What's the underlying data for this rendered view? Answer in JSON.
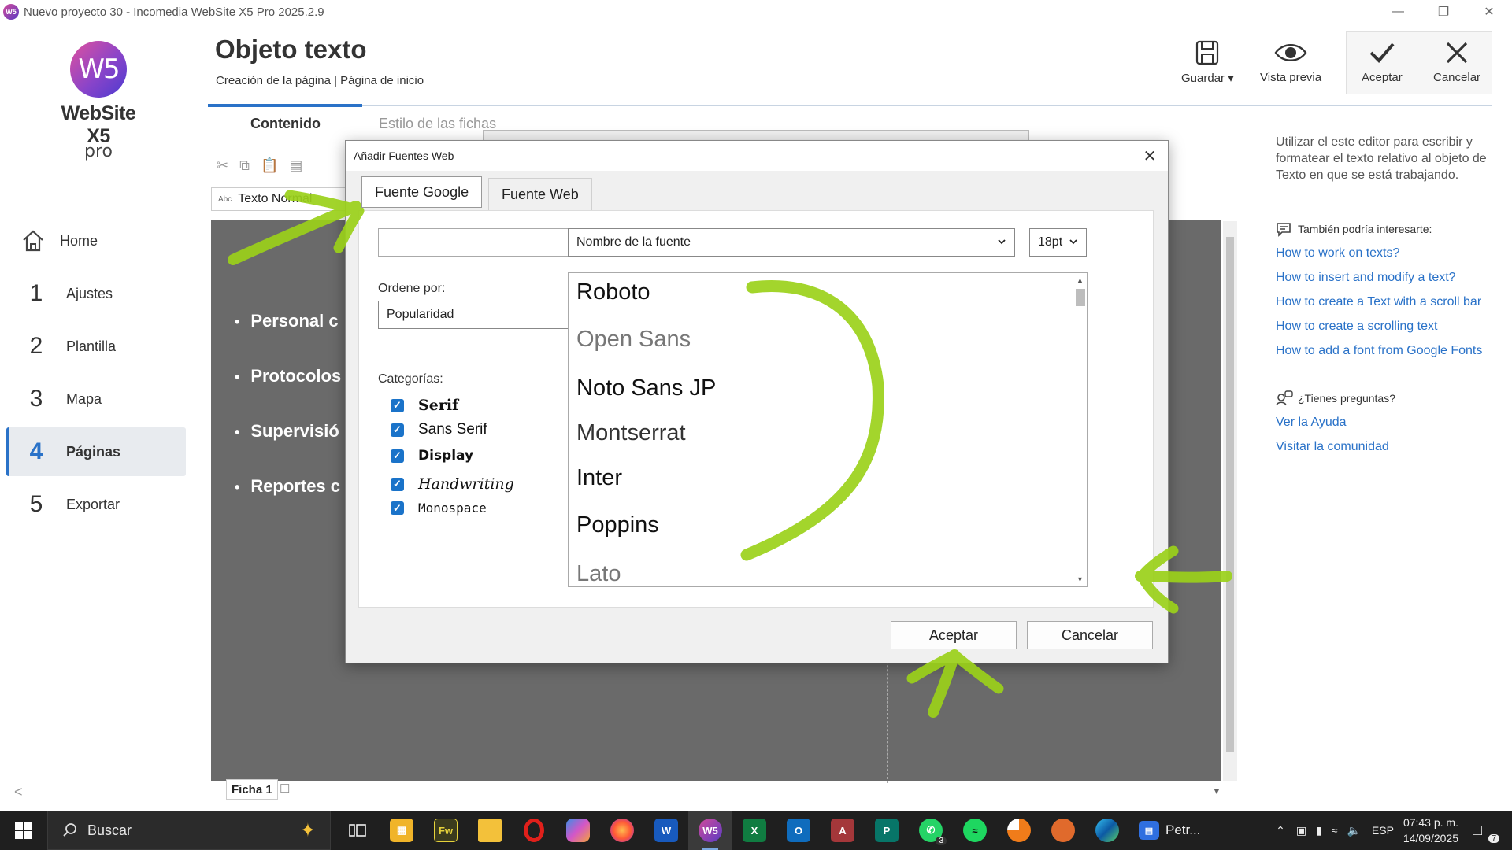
{
  "window": {
    "title": "Nuevo proyecto 30 - Incomedia WebSite X5 Pro 2025.2.9",
    "icon_text": "W5",
    "controls": [
      "minimize-icon",
      "restore-icon",
      "close-icon"
    ]
  },
  "logo": {
    "mark": "W5",
    "name": "WebSite X5",
    "edition": "pro"
  },
  "nav": {
    "items": [
      {
        "num": "",
        "label": "Home",
        "icon": "home-icon"
      },
      {
        "num": "1",
        "label": "Ajustes"
      },
      {
        "num": "2",
        "label": "Plantilla"
      },
      {
        "num": "3",
        "label": "Mapa"
      },
      {
        "num": "4",
        "label": "Páginas",
        "active": true
      },
      {
        "num": "5",
        "label": "Exportar"
      }
    ],
    "collapse": "<"
  },
  "header": {
    "title": "Objeto texto",
    "breadcrumb": "Creación de la página | Página de inicio",
    "tabs": {
      "content": "Contenido",
      "style": "Estilo de las fichas"
    },
    "save": "Guardar ▾",
    "preview": "Vista previa",
    "accept": "Aceptar",
    "cancel": "Cancelar"
  },
  "help": {
    "intro": "Utilizar el este editor para escribir y formatear el texto relativo al objeto de Texto en que se está trabajando.",
    "related_title": "También podría interesarte:",
    "links": [
      "How to work on texts?",
      "How to insert and modify a text?",
      "How to create a Text with a scroll bar",
      "How to create a scrolling text",
      "How to add a font from Google Fonts"
    ],
    "questions_title": "¿Tienes preguntas?",
    "support_links": [
      "Ver la Ayuda",
      "Visitar la comunidad"
    ]
  },
  "editor": {
    "style_prefix": "Abc",
    "style_value": "Texto Normal",
    "bullets": [
      "Personal c",
      "Protocolos",
      "Supervisió",
      "Reportes c"
    ],
    "sheet_tab": "Ficha 1"
  },
  "dialog": {
    "title": "Añadir Fuentes Web",
    "tabs": {
      "google": "Fuente Google",
      "web": "Fuente Web"
    },
    "search": {
      "value": "",
      "placeholder": ""
    },
    "font_name_select": "Nombre de la fuente",
    "size_select": "18pt",
    "order_label": "Ordene por:",
    "order_value": "Popularidad",
    "categories_label": "Categorías:",
    "categories": [
      {
        "label": "Serif",
        "checked": true
      },
      {
        "label": "Sans Serif",
        "checked": true
      },
      {
        "label": "Display",
        "checked": true
      },
      {
        "label": "Handwriting",
        "checked": true
      },
      {
        "label": "Monospace",
        "checked": true
      }
    ],
    "fonts": [
      "Roboto",
      "Open Sans",
      "Noto Sans JP",
      "Montserrat",
      "Inter",
      "Poppins",
      "Lato"
    ],
    "accept": "Aceptar",
    "cancel": "Cancelar"
  },
  "taskbar": {
    "search": "Buscar",
    "active_app_label": "Petr...",
    "lang": "ESP",
    "time": "07:43 p. m.",
    "date": "14/09/2025",
    "notif_count": "7",
    "whatsapp_badge": "3",
    "apps": [
      "Fw",
      "W",
      "W5",
      "X",
      "O",
      "A",
      "P"
    ]
  },
  "colors": {
    "accent": "#2a72c8",
    "annotation": "#9bd11a",
    "canvas": "#6a6a6a"
  }
}
